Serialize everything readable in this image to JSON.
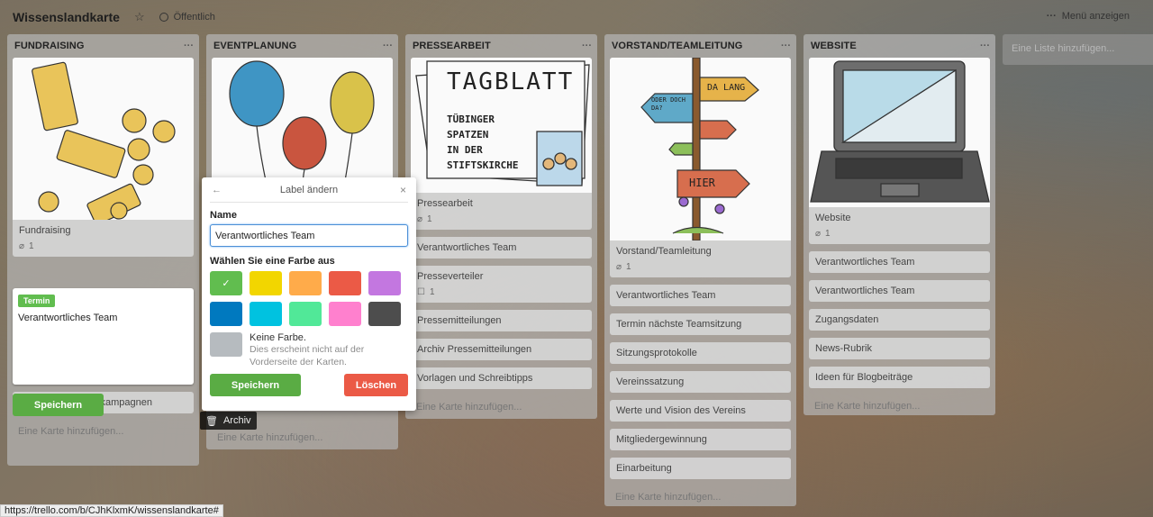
{
  "header": {
    "board_title": "Wissenslandkarte",
    "star": "☆",
    "visibility": "Öffentlich",
    "menu_dots": "···",
    "menu_label": "Menü anzeigen"
  },
  "lists": {
    "menu_dots": "···",
    "add_card": "Eine Karte hinzufügen...",
    "add_list": "Eine Liste hinzufügen...",
    "fundraising": {
      "title": "FUNDRAISING",
      "cover_card": {
        "title": "Fundraising",
        "attachments": "1"
      },
      "cards": [
        "Ideen für Spendenkampagnen"
      ]
    },
    "eventplanung": {
      "title": "EVENTPLANUNG"
    },
    "presse": {
      "title": "PRESSEARBEIT",
      "cover_card": {
        "title": "Pressearbeit",
        "attachments": "1"
      },
      "cover_text": {
        "headline": "TAGBLATT",
        "line1": "TÜBINGER",
        "line2": "SPATZEN",
        "line3": "IN DER",
        "line4": "STIFTSKIRCHE"
      },
      "cards": [
        {
          "title": "Verantwortliches Team"
        },
        {
          "title": "Presseverteiler",
          "checklist": "1"
        },
        {
          "title": "Pressemitteilungen"
        },
        {
          "title": "Archiv Pressemitteilungen"
        },
        {
          "title": "Vorlagen und Schreibtipps"
        }
      ]
    },
    "vorstand": {
      "title": "VORSTAND/TEAMLEITUNG",
      "cover_card": {
        "title": "Vorstand/Teamleitung",
        "attachments": "1"
      },
      "signs": {
        "a": "DA LANG",
        "b": "ODER DOCH DA?",
        "c": "HIER"
      },
      "cards": [
        "Verantwortliches Team",
        "Termin nächste Teamsitzung",
        "Sitzungsprotokolle",
        "Vereinssatzung",
        "Werte und Vision des Vereins",
        "Mitgliedergewinnung",
        "Einarbeitung"
      ]
    },
    "website": {
      "title": "WEBSITE",
      "cover_card": {
        "title": "Website",
        "attachments": "1"
      },
      "cards": [
        "Verantwortliches Team",
        "Verantwortliches Team",
        "Zugangsdaten",
        "News-Rubrik",
        "Ideen für Blogbeiträge"
      ]
    }
  },
  "edit_card": {
    "label": "Termin",
    "text": "Verantwortliches Team",
    "save": "Speichern",
    "archive": "Archiv"
  },
  "popover": {
    "back": "←",
    "title": "Label ändern",
    "close": "×",
    "name_label": "Name",
    "name_value": "Verantwortliches Team",
    "color_label": "Wählen Sie eine Farbe aus",
    "selected_mark": "✓",
    "colors": [
      "#61bd4f",
      "#f2d600",
      "#ffab4a",
      "#eb5a46",
      "#c377e0",
      "#0079bf",
      "#00c2e0",
      "#51e898",
      "#ff80ce",
      "#4d4d4d"
    ],
    "no_color_title": "Keine Farbe.",
    "no_color_desc": "Dies erscheint nicht auf der Vorderseite der Karten.",
    "save": "Speichern",
    "delete": "Löschen"
  },
  "status_bar": {
    "url": "https://trello.com/b/CJhKlxmK/wissenslandkarte#"
  }
}
